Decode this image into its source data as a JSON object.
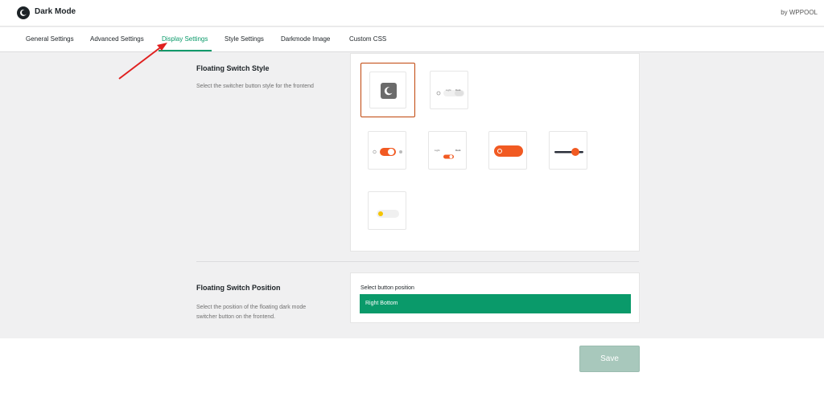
{
  "header": {
    "title": "Dark Mode",
    "vendor": "by WPPOOL"
  },
  "tabs": [
    {
      "label": "General Settings"
    },
    {
      "label": "Advanced Settings"
    },
    {
      "label": "Display Settings",
      "active": true
    },
    {
      "label": "Style Settings"
    },
    {
      "label": "Darkmode Image"
    },
    {
      "label": "Custom CSS"
    }
  ],
  "floating_switch_style": {
    "title": "Floating Switch Style",
    "description": "Select the switcher button style for the frontend",
    "options": [
      {
        "icon": "moon-square-icon",
        "selected": true
      },
      {
        "icon": "light-dark-toggle-icon",
        "text": [
          "Light",
          "Dark"
        ]
      },
      {
        "icon": "sun-moon-toggle-icon"
      },
      {
        "icon": "light-dark-small-toggle-icon",
        "text": [
          "Light",
          "Dark"
        ]
      },
      {
        "icon": "orange-pill-toggle-icon"
      },
      {
        "icon": "slider-toggle-icon"
      },
      {
        "icon": "yellow-dot-toggle-icon"
      }
    ]
  },
  "floating_switch_position": {
    "title": "Floating Switch Position",
    "description": "Select the position of the floating dark mode switcher button on the frontend.",
    "select_label": "Select button position",
    "selected_value": "Right Bottom"
  },
  "footer": {
    "save_label": "Save"
  },
  "colors": {
    "accent": "#0a9a6a",
    "toggle_orange": "#f15a22",
    "selected_border": "#c0450a",
    "annotation_arrow": "#e0201f"
  }
}
